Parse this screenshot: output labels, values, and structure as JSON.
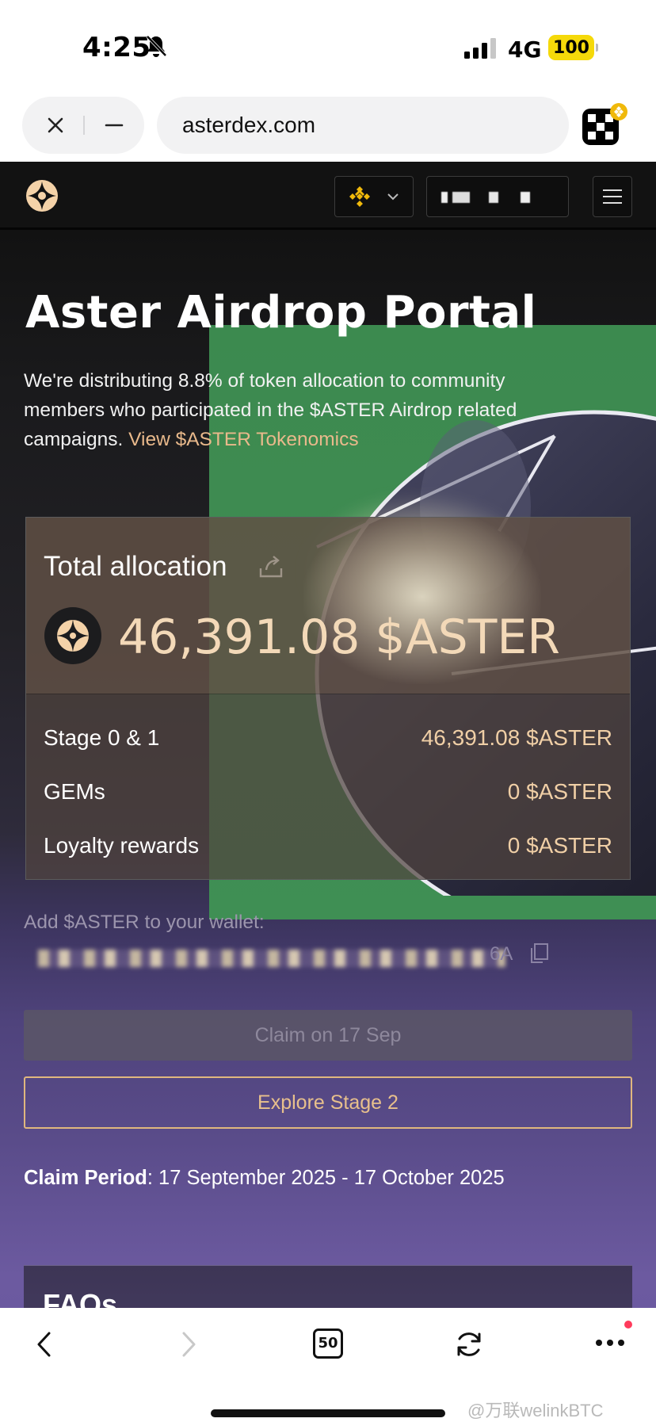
{
  "status_bar": {
    "time": "4:25",
    "network": "4G",
    "battery": "100"
  },
  "browser": {
    "url": "asterdex.com",
    "tab_count": "50"
  },
  "nav": {
    "chain_icon": "bnb-icon",
    "menu_icon": "hamburger-icon"
  },
  "page": {
    "title": "Aster Airdrop Portal",
    "intro_text": "We're distributing 8.8% of token allocation to community members who participated in the $ASTER Airdrop related campaigns.",
    "tokenomics_link": "View $ASTER Tokenomics",
    "allocation": {
      "label": "Total allocation",
      "total": "46,391.08 $ASTER",
      "rows": [
        {
          "label": "Stage 0 & 1",
          "value": "46,391.08 $ASTER"
        },
        {
          "label": "GEMs",
          "value": "0 $ASTER"
        },
        {
          "label": "Loyalty rewards",
          "value": "0 $ASTER"
        }
      ]
    },
    "wallet_hint": "Add $ASTER to your wallet:",
    "contract_suffix": "6A",
    "claim_button": "Claim on 17 Sep",
    "explore_button": "Explore Stage 2",
    "claim_period_label": "Claim Period",
    "claim_period_value": ": 17 September 2025 - 17 October 2025",
    "faq_title": "FAQs"
  },
  "watermark": "@万联welinkBTC",
  "colors": {
    "accent_gold": "#e8c08c",
    "green_panel": "#3f8a51",
    "battery": "#f5d90a"
  }
}
